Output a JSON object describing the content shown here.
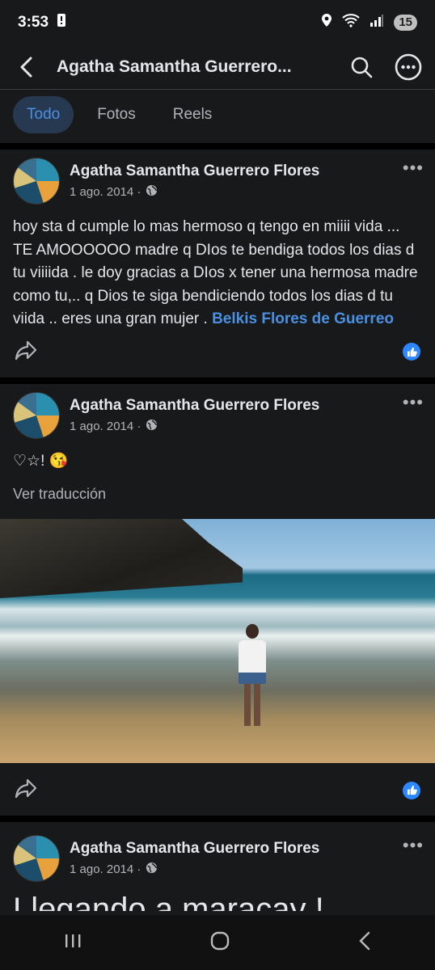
{
  "status_bar": {
    "time": "3:53",
    "battery": "15"
  },
  "header": {
    "title": "Agatha Samantha Guerrero..."
  },
  "tabs": [
    {
      "label": "Todo",
      "active": true
    },
    {
      "label": "Fotos",
      "active": false
    },
    {
      "label": "Reels",
      "active": false
    }
  ],
  "posts": [
    {
      "author": "Agatha Samantha Guerrero Flores",
      "date": "1 ago. 2014 ·",
      "text": "hoy sta d cumple lo mas hermoso q tengo en miiii vida ... TE AMOOOOOO  madre q DIos te bendiga todos los dias d tu viiiida .   le doy gracias a DIos x tener una hermosa madre como tu,.. q Dios te siga bendiciendo todos los dias d tu viida .. eres una gran mujer . ",
      "mention": "Belkis Flores de Guerreo"
    },
    {
      "author": "Agatha Samantha Guerrero Flores",
      "date": "1 ago. 2014 ·",
      "text": "♡☆! 😘",
      "translate": "Ver traducción"
    },
    {
      "author": "Agatha Samantha Guerrero Flores",
      "date": "1 ago. 2014 ·",
      "text": "Llegando a maracay !"
    }
  ],
  "icons": {
    "back": "back-arrow-icon",
    "search": "search-icon",
    "more": "more-options-icon",
    "globe": "globe-icon",
    "share": "share-icon",
    "like": "like-reaction-icon"
  },
  "colors": {
    "accent": "#4a90e2",
    "background": "#18191a",
    "like": "#2d88ff"
  }
}
